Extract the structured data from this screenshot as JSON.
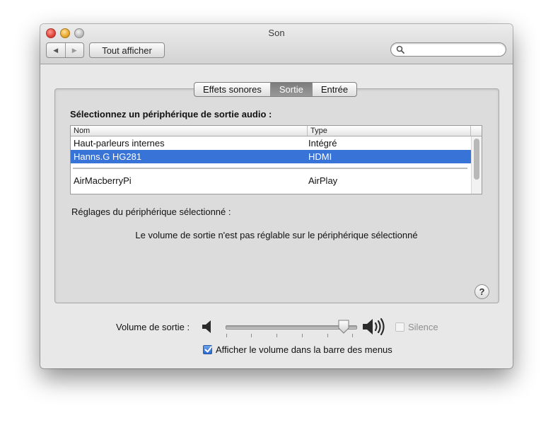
{
  "window": {
    "title": "Son"
  },
  "toolbar": {
    "back_glyph": "◀",
    "forward_glyph": "▶",
    "show_all_label": "Tout afficher",
    "search_placeholder": "",
    "search_value": ""
  },
  "tabs": [
    {
      "label": "Effets sonores",
      "active": false
    },
    {
      "label": "Sortie",
      "active": true
    },
    {
      "label": "Entrée",
      "active": false
    }
  ],
  "output": {
    "section_title": "Sélectionnez un périphérique de sortie audio :",
    "columns": [
      "Nom",
      "Type"
    ],
    "rows": [
      {
        "name": "Haut-parleurs internes",
        "type": "Intégré",
        "selected": false
      },
      {
        "name": "Hanns.G HG281",
        "type": "HDMI",
        "selected": true
      },
      {
        "name": "AirMacberryPi",
        "type": "AirPlay",
        "selected": false
      }
    ],
    "settings_label": "Réglages du périphérique sélectionné :",
    "settings_message": "Le volume de sortie n'est pas réglable sur le périphérique sélectionné",
    "help_glyph": "?"
  },
  "volume": {
    "label": "Volume de sortie :",
    "level": 0.95,
    "mute_label": "Silence",
    "mute_checked": false,
    "mute_enabled": false,
    "show_in_menubar_label": "Afficher le volume dans la barre des menus",
    "show_in_menubar_checked": true
  },
  "colors": {
    "selection": "#3874d8",
    "active_tab": "#8a8a8a"
  }
}
